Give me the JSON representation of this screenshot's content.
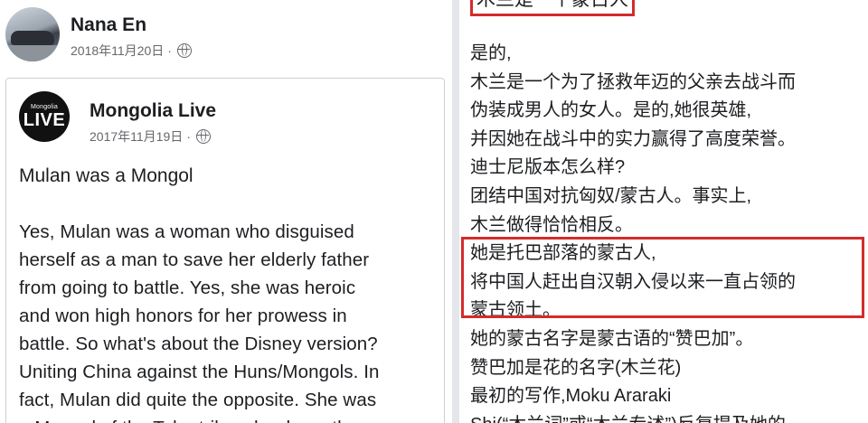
{
  "outer_post": {
    "author": "Nana En",
    "date": "2018年11月20日",
    "separator": "·",
    "audience_icon": "globe-icon"
  },
  "shared_post": {
    "page_name": "Mongolia Live",
    "avatar_text_small": "Mongolia",
    "avatar_text_big": "LIVE",
    "date": "2017年11月19日",
    "separator": "·",
    "audience_icon": "globe-icon",
    "title": "Mulan was a Mongol",
    "body": "Yes, Mulan was a woman who disguised\nherself as a man to save her elderly father\nfrom going to battle. Yes, she was heroic\nand won high honors for her prowess in\nbattle. So what's about the Disney version?\nUniting China against the Huns/Mongols. In\nfact, Mulan did quite the opposite. She was\na Mongol of the Toba tribe who drove the"
  },
  "translation": {
    "title": "木兰是一个蒙古人",
    "lines": [
      "是的,",
      "木兰是一个为了拯救年迈的父亲去战斗而",
      "伪装成男人的女人。是的,她很英雄,",
      "并因她在战斗中的实力赢得了高度荣誉。",
      "迪士尼版本怎么样?",
      "团结中国对抗匈奴/蒙古人。事实上,",
      "木兰做得恰恰相反。",
      "她是托巴部落的蒙古人,",
      "将中国人赶出自汉朝入侵以来一直占领的",
      "蒙古领土。",
      "她的蒙古名字是蒙古语的“赞巴加”。",
      "赞巴加是花的名字(木兰花)",
      "最初的写作,Moku Araraki",
      "Shi(“木兰词”或“木兰专述”)反复提及她的"
    ],
    "highlight_color": "#d42b2b"
  }
}
